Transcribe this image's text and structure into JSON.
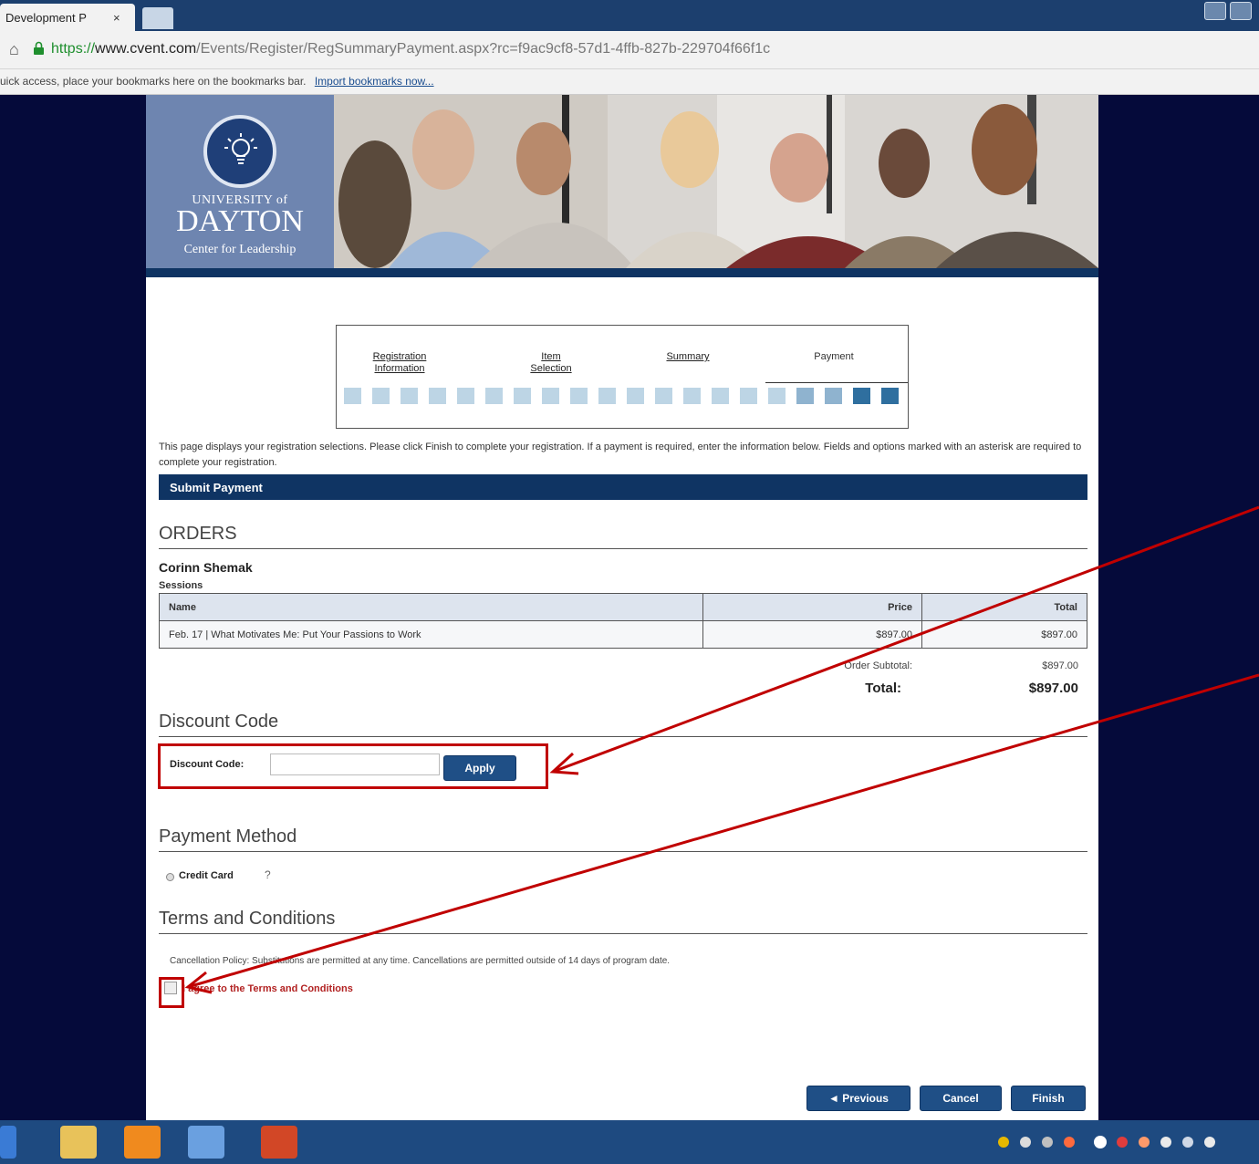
{
  "browser": {
    "tab_title": "Development P",
    "tab_close": "×",
    "url_protocol": "https://",
    "url_host": "www.cvent.com",
    "url_path": "/Events/Register/RegSummaryPayment.aspx?rc=f9ac9cf8-57d1-4ffb-827b-229704f66f1c",
    "bookmarks_text": "uick access, place your bookmarks here on the bookmarks bar.",
    "bookmarks_import": "Import bookmarks now..."
  },
  "header": {
    "univ": "UNIVERSITY of",
    "name": "DAYTON",
    "sub": "Center for Leadership",
    "bulb_icon": "lightbulb-icon"
  },
  "progress": {
    "steps": [
      {
        "line1": "Registration",
        "line2": "Information"
      },
      {
        "line1": "Item",
        "line2": "Selection"
      },
      {
        "line1": "",
        "line2": "Summary"
      },
      {
        "line1": "",
        "line2": "Payment"
      }
    ],
    "filled_segments": 4,
    "total_segments": 20,
    "colors": {
      "light": "#bdd5e5",
      "mid": "#8fb3cf",
      "dark": "#2f6f9f"
    }
  },
  "intro": "This page displays your registration selections. Please click Finish to complete your registration. If a payment is required, enter the information below. Fields and options marked with an asterisk are required to complete your registration.",
  "submit_bar": "Submit Payment",
  "orders": {
    "heading": "ORDERS",
    "attendee": "Corinn Shemak",
    "sessions_label": "Sessions",
    "columns": [
      "Name",
      "Price",
      "Total"
    ],
    "rows": [
      [
        "Feb. 17 | What Motivates Me: Put Your Passions to Work",
        "$897.00",
        "$897.00"
      ]
    ],
    "subtotal_label": "Order Subtotal:",
    "subtotal_value": "$897.00",
    "total_label": "Total:",
    "total_value": "$897.00"
  },
  "discount": {
    "heading": "Discount Code",
    "label": "Discount Code:",
    "value": "",
    "apply": "Apply"
  },
  "payment": {
    "heading": "Payment Method",
    "option": "Credit Card",
    "help": "?"
  },
  "terms": {
    "heading": "Terms and Conditions",
    "policy": "Cancellation Policy: Substitutions are permitted at any time. Cancellations are permitted outside of 14 days of program date.",
    "agree": "I agree to the Terms and Conditions"
  },
  "buttons": {
    "previous": "◄ Previous",
    "cancel": "Cancel",
    "finish": "Finish"
  },
  "annotation_color": "#c00000"
}
